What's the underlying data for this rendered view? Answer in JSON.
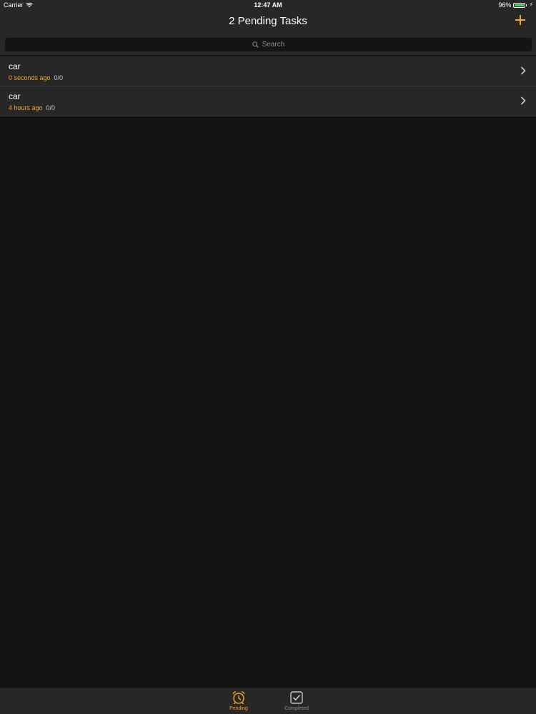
{
  "status_bar": {
    "carrier": "Carrier",
    "time": "12:47 AM",
    "battery": "96%",
    "battery_level": 0.96
  },
  "nav": {
    "title": "2 Pending Tasks"
  },
  "search": {
    "placeholder": "Search"
  },
  "tasks": [
    {
      "title": "car",
      "time": "0 seconds ago",
      "progress": "0/0"
    },
    {
      "title": "car",
      "time": "4 hours ago",
      "progress": "0/0"
    }
  ],
  "tabs": [
    {
      "label": "Pending",
      "icon": "alarm-clock-icon",
      "selected": true
    },
    {
      "label": "Completed",
      "icon": "checkbox-icon",
      "selected": false
    }
  ],
  "colors": {
    "accent": "#f5a623",
    "battery_green": "#4cd964",
    "background": "#141314",
    "bar": "#272728"
  }
}
